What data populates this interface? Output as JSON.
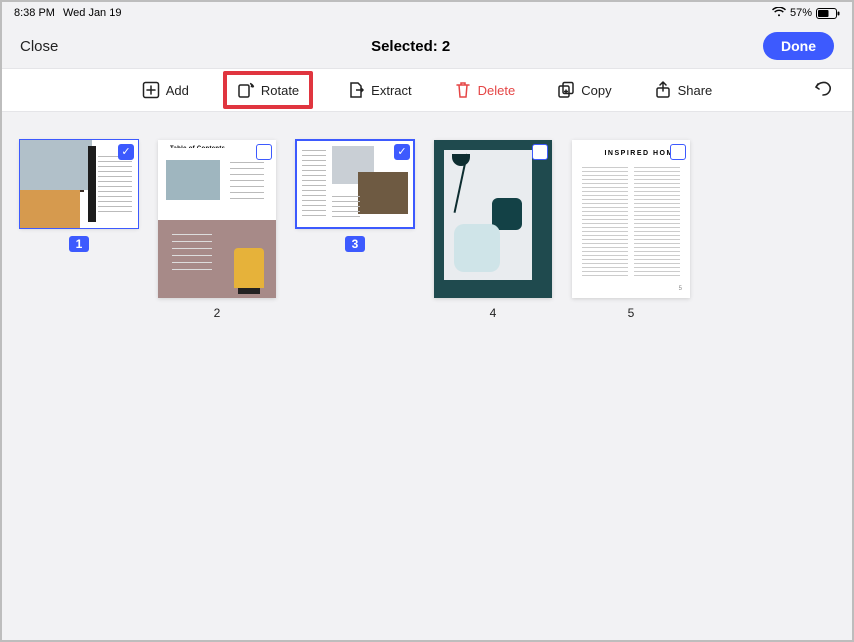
{
  "status": {
    "time": "8:38 PM",
    "date": "Wed Jan 19",
    "battery_pct": "57%"
  },
  "nav": {
    "close_label": "Close",
    "title": "Selected: 2",
    "done_label": "Done"
  },
  "toolbar": {
    "add_label": "Add",
    "rotate_label": "Rotate",
    "extract_label": "Extract",
    "delete_label": "Delete",
    "copy_label": "Copy",
    "share_label": "Share"
  },
  "highlight": "rotate",
  "pages": [
    {
      "num": "1",
      "selected": true,
      "orientation": "landscape",
      "kind": "cover",
      "title": ""
    },
    {
      "num": "2",
      "selected": false,
      "orientation": "portrait",
      "kind": "toc",
      "title": "Table of Contents"
    },
    {
      "num": "3",
      "selected": true,
      "orientation": "landscape",
      "kind": "spread",
      "title": ""
    },
    {
      "num": "4",
      "selected": false,
      "orientation": "portrait",
      "kind": "photo",
      "title": ""
    },
    {
      "num": "5",
      "selected": false,
      "orientation": "portrait",
      "kind": "article",
      "title": "INSPIRED HOME",
      "folio": "5"
    }
  ]
}
